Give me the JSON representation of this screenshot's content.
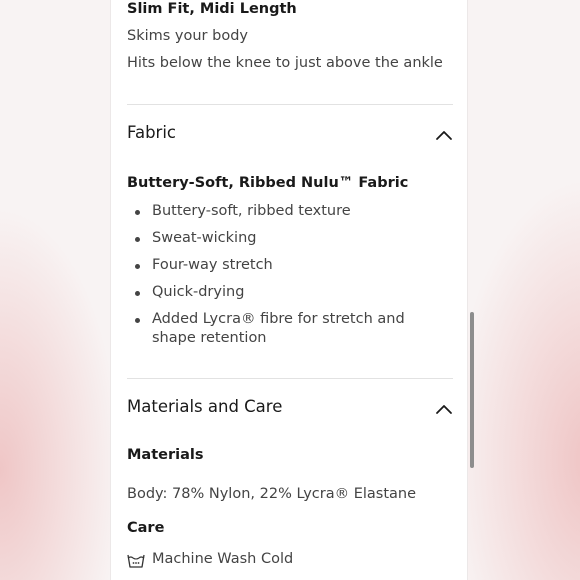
{
  "fit": {
    "heading": "Slim Fit, Midi Length",
    "lines": [
      "Skims your body",
      "Hits below the knee to just above the ankle"
    ]
  },
  "fabric": {
    "title": "Fabric",
    "subheading": "Buttery-Soft, Ribbed Nulu™ Fabric",
    "features": [
      "Buttery-soft, ribbed texture",
      "Sweat-wicking",
      "Four-way stretch",
      "Quick-drying",
      "Added Lycra® fibre for stretch and shape retention"
    ]
  },
  "materials_care": {
    "title": "Materials and Care",
    "materials_heading": "Materials",
    "materials_text": "Body: 78% Nylon, 22% Lycra® Elastane",
    "care_heading": "Care",
    "care_items": [
      {
        "icon": "machine-wash-icon",
        "text": "Machine Wash Cold"
      }
    ]
  },
  "icons": {
    "collapse": "chevron-up-icon"
  }
}
